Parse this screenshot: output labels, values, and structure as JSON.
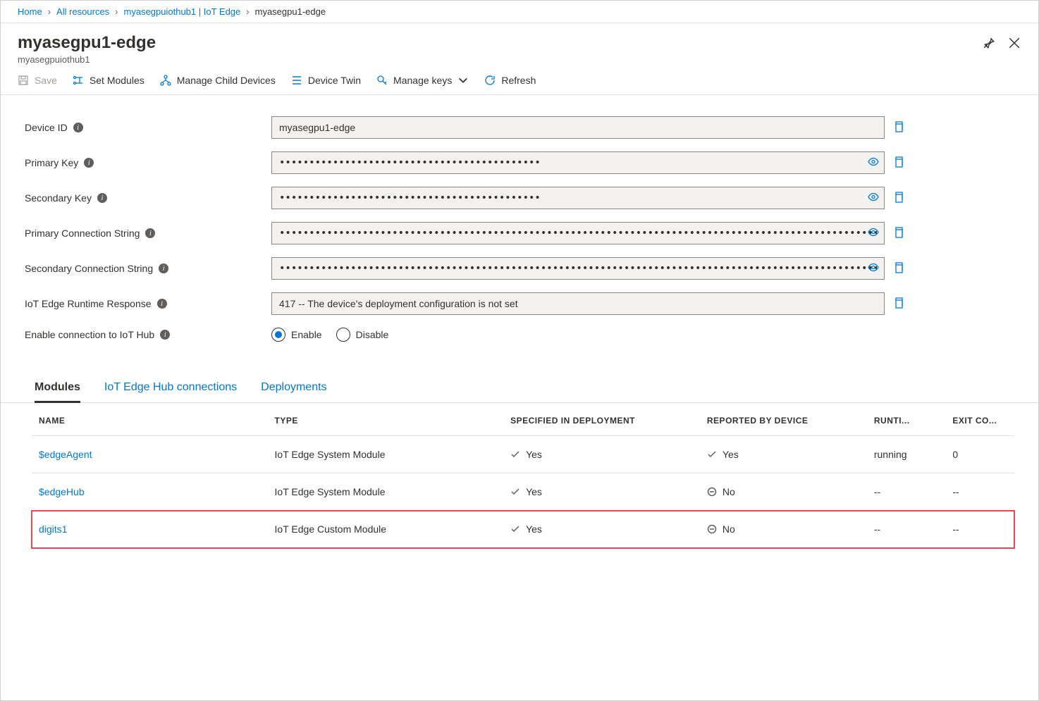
{
  "breadcrumb": {
    "home": "Home",
    "all_resources": "All resources",
    "hub": "myasegpuiothub1 | IoT Edge",
    "current": "myasegpu1-edge"
  },
  "header": {
    "title": "myasegpu1-edge",
    "subtitle": "myasegpuiothub1"
  },
  "toolbar": {
    "save": "Save",
    "set_modules": "Set Modules",
    "manage_child": "Manage Child Devices",
    "device_twin": "Device Twin",
    "manage_keys": "Manage keys",
    "refresh": "Refresh"
  },
  "form": {
    "device_id_label": "Device ID",
    "device_id_value": "myasegpu1-edge",
    "primary_key_label": "Primary Key",
    "primary_key_value": "••••••••••••••••••••••••••••••••••••••••••••",
    "secondary_key_label": "Secondary Key",
    "secondary_key_value": "••••••••••••••••••••••••••••••••••••••••••••",
    "primary_cs_label": "Primary Connection String",
    "primary_cs_value": "•••••••••••••••••••••••••••••••••••••••••••••••••••••••••••••••••••••••••••••••••••••••••••••••••••••••••••••••••••••••••••••••••••••••••••••••••••••••...",
    "secondary_cs_label": "Secondary Connection String",
    "secondary_cs_value": "•••••••••••••••••••••••••••••••••••••••••••••••••••••••••••••••••••••••••••••••••••••••••••••••••••••••••••••••••••••••••••••••••••••••••••••••••••••••...",
    "runtime_label": "IoT Edge Runtime Response",
    "runtime_value": "417 -- The device's deployment configuration is not set",
    "enable_conn_label": "Enable connection to IoT Hub",
    "enable": "Enable",
    "disable": "Disable"
  },
  "tabs": {
    "modules": "Modules",
    "connections": "IoT Edge Hub connections",
    "deployments": "Deployments"
  },
  "table": {
    "headers": {
      "name": "NAME",
      "type": "TYPE",
      "specified": "SPECIFIED IN DEPLOYMENT",
      "reported": "REPORTED BY DEVICE",
      "runtime": "RUNTI...",
      "exit": "EXIT CO..."
    },
    "rows": [
      {
        "name": "$edgeAgent",
        "type": "IoT Edge System Module",
        "specified": "Yes",
        "specified_ok": true,
        "reported": "Yes",
        "reported_ok": true,
        "runtime": "running",
        "exit": "0"
      },
      {
        "name": "$edgeHub",
        "type": "IoT Edge System Module",
        "specified": "Yes",
        "specified_ok": true,
        "reported": "No",
        "reported_ok": false,
        "runtime": "--",
        "exit": "--"
      },
      {
        "name": "digits1",
        "type": "IoT Edge Custom Module",
        "specified": "Yes",
        "specified_ok": true,
        "reported": "No",
        "reported_ok": false,
        "runtime": "--",
        "exit": "--"
      }
    ]
  }
}
